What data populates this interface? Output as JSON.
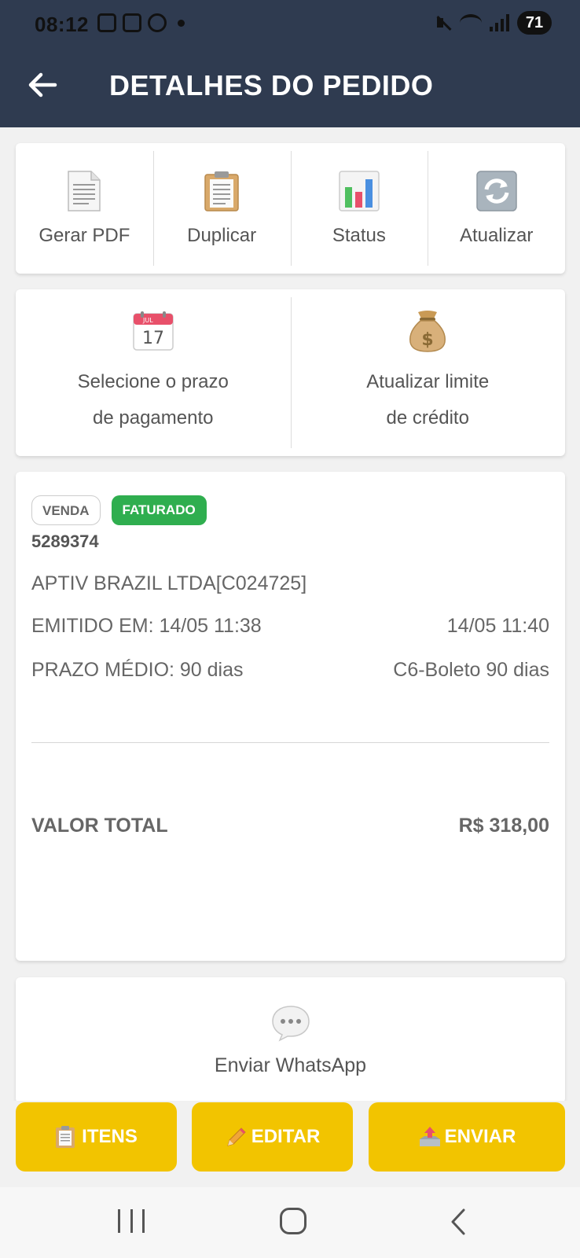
{
  "status_bar": {
    "time": "08:12",
    "battery": "71"
  },
  "header": {
    "title": "DETALHES DO PEDIDO"
  },
  "actions": [
    {
      "label": "Gerar PDF",
      "icon": "pdf-document-icon"
    },
    {
      "label": "Duplicar",
      "icon": "clipboard-icon"
    },
    {
      "label": "Status",
      "icon": "bar-chart-icon"
    },
    {
      "label": "Atualizar",
      "icon": "refresh-icon"
    }
  ],
  "payment": {
    "prazo_line1": "Selecione o prazo",
    "prazo_line2": "de pagamento",
    "calendar_month": "JUL",
    "calendar_day": "17",
    "limite_line1": "Atualizar limite",
    "limite_line2": "de crédito"
  },
  "order": {
    "type_badge": "VENDA",
    "status_badge": "FATURADO",
    "number": "5289374",
    "client": "APTIV BRAZIL LTDA[C024725]",
    "emitido": "EMITIDO EM: 14/05 11:38",
    "emitido_right": "14/05 11:40",
    "prazo": "PRAZO MÉDIO: 90 dias",
    "prazo_right": "C6-Boleto 90 dias",
    "total_label": "VALOR TOTAL",
    "total_value": "R$ 318,00"
  },
  "whatsapp": {
    "label": "Enviar WhatsApp"
  },
  "bottom_buttons": {
    "itens": "ITENS",
    "editar": "EDITAR",
    "enviar": "ENVIAR"
  },
  "colors": {
    "header_bg": "#2f3b50",
    "button_yellow": "#f2c400",
    "badge_green": "#2fae4f"
  }
}
